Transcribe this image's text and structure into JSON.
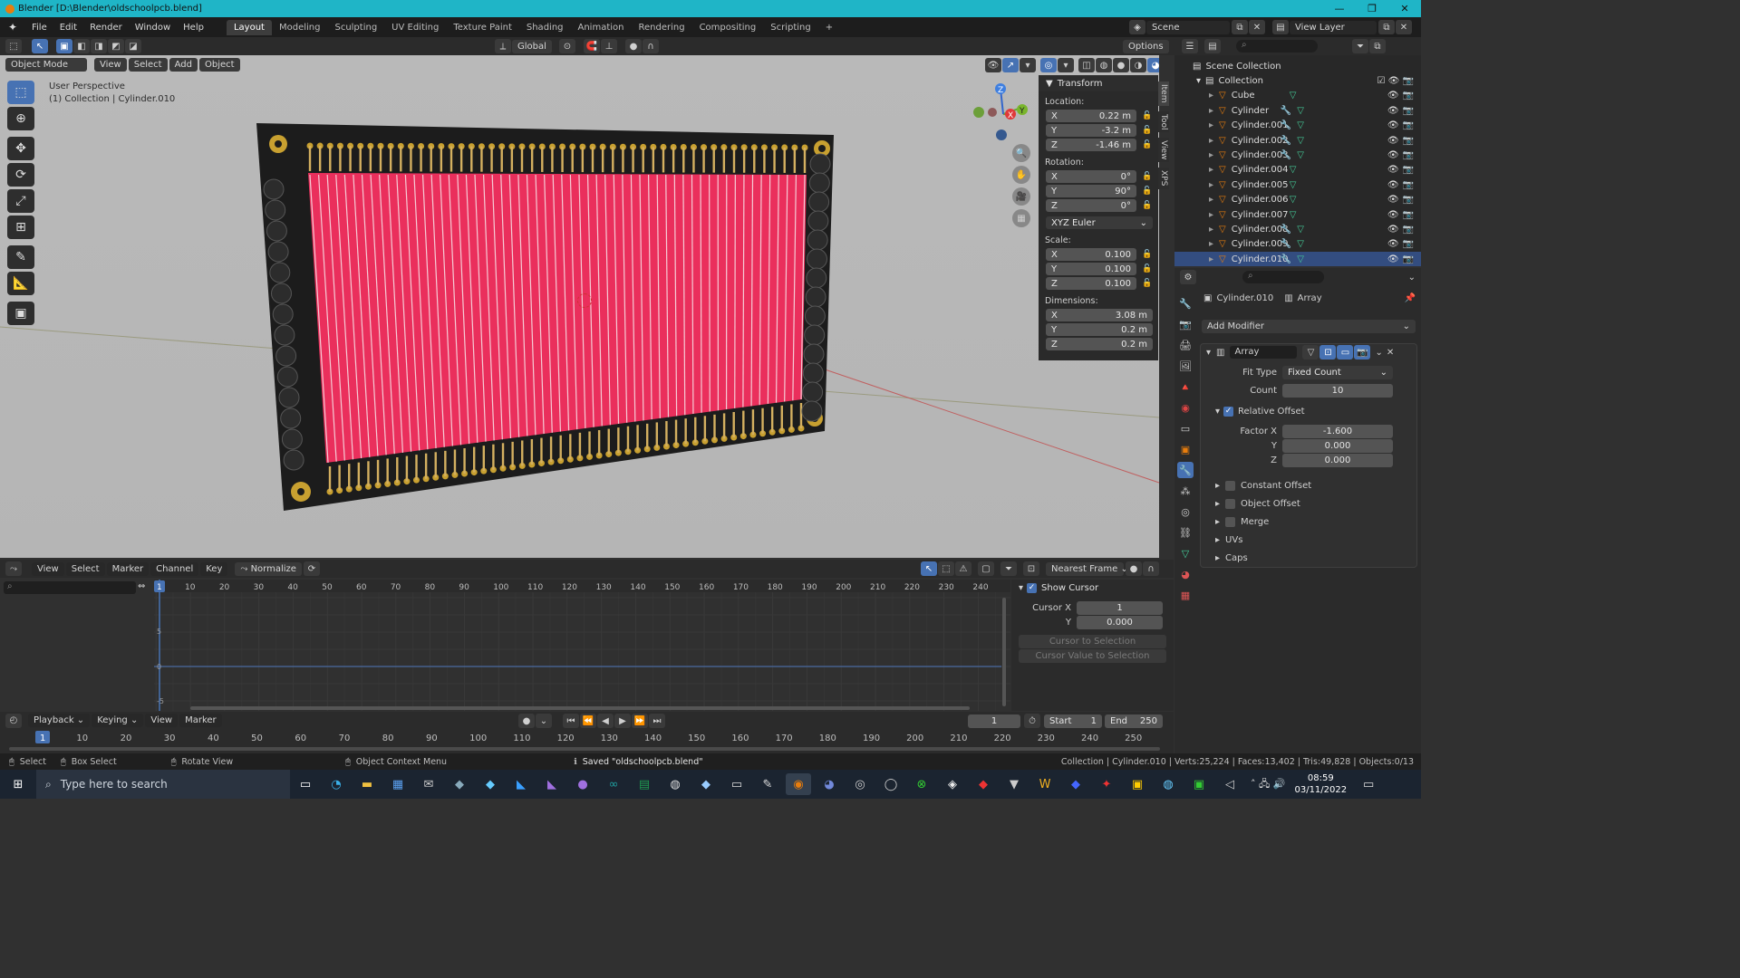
{
  "window": {
    "title": "Blender [D:\\Blender\\oldschoolpcb.blend]",
    "minimize": "—",
    "maximize": "❐",
    "close": "✕"
  },
  "menubar": {
    "menus": [
      "File",
      "Edit",
      "Render",
      "Window",
      "Help"
    ],
    "workspaces": [
      "Layout",
      "Modeling",
      "Sculpting",
      "UV Editing",
      "Texture Paint",
      "Shading",
      "Animation",
      "Rendering",
      "Compositing",
      "Scripting"
    ],
    "active_workspace": "Layout",
    "add_tab": "+",
    "scene": "Scene",
    "view_layer": "View Layer"
  },
  "tool_header": {
    "transform_orientation": "Global",
    "options": "Options"
  },
  "viewport_header": {
    "mode": "Object Mode",
    "menus": [
      "View",
      "Select",
      "Add",
      "Object"
    ]
  },
  "viewport": {
    "perspective": "User Perspective",
    "collection_info": "(1) Collection | Cylinder.010",
    "gizmo_axes": [
      "X",
      "Y",
      "Z"
    ]
  },
  "transform_panel": {
    "title": "Transform",
    "location_label": "Location:",
    "location": {
      "x": "0.22 m",
      "y": "-3.2 m",
      "z": "-1.46 m"
    },
    "rotation_label": "Rotation:",
    "rotation": {
      "x": "0°",
      "y": "90°",
      "z": "0°"
    },
    "rotation_mode": "XYZ Euler",
    "scale_label": "Scale:",
    "scale": {
      "x": "0.100",
      "y": "0.100",
      "z": "0.100"
    },
    "dimensions_label": "Dimensions:",
    "dimensions": {
      "x": "3.08 m",
      "y": "0.2 m",
      "z": "0.2 m"
    },
    "axis_labels": [
      "X",
      "Y",
      "Z"
    ]
  },
  "sidebar_tabs": [
    "Item",
    "Tool",
    "View",
    "XPS"
  ],
  "outliner": {
    "scene_collection": "Scene Collection",
    "collection": "Collection",
    "items": [
      {
        "name": "Cube",
        "modifier": false
      },
      {
        "name": "Cylinder",
        "modifier": true
      },
      {
        "name": "Cylinder.001",
        "modifier": true
      },
      {
        "name": "Cylinder.002",
        "modifier": true
      },
      {
        "name": "Cylinder.003",
        "modifier": true
      },
      {
        "name": "Cylinder.004",
        "modifier": false
      },
      {
        "name": "Cylinder.005",
        "modifier": false
      },
      {
        "name": "Cylinder.006",
        "modifier": false
      },
      {
        "name": "Cylinder.007",
        "modifier": false
      },
      {
        "name": "Cylinder.008",
        "modifier": true
      },
      {
        "name": "Cylinder.009",
        "modifier": true
      },
      {
        "name": "Cylinder.010",
        "modifier": true
      }
    ]
  },
  "properties": {
    "object_name": "Cylinder.010",
    "modifier_context": "Array",
    "add_modifier": "Add Modifier",
    "modifier_name": "Array",
    "fit_type_label": "Fit Type",
    "fit_type": "Fixed Count",
    "count_label": "Count",
    "count": "10",
    "relative_offset": "Relative Offset",
    "factor_x_label": "Factor X",
    "factor_x": "-1.600",
    "factor_y_label": "Y",
    "factor_y": "0.000",
    "factor_z_label": "Z",
    "factor_z": "0.000",
    "subpanels": [
      "Constant Offset",
      "Object Offset",
      "Merge",
      "UVs",
      "Caps"
    ]
  },
  "graph_editor": {
    "menus": [
      "View",
      "Select",
      "Marker",
      "Channel",
      "Key"
    ],
    "normalize": "Normalize",
    "snap": "Nearest Frame",
    "current_frame": "1",
    "ruler": [
      "10",
      "20",
      "30",
      "40",
      "50",
      "60",
      "70",
      "80",
      "90",
      "100",
      "110",
      "120",
      "130",
      "140",
      "150",
      "160",
      "170",
      "180",
      "190",
      "200",
      "210",
      "220",
      "230",
      "240"
    ],
    "y_ticks": [
      "5",
      "0",
      "-5"
    ],
    "show_cursor": "Show Cursor",
    "cursor_x_label": "Cursor X",
    "cursor_x": "1",
    "cursor_y_label": "Y",
    "cursor_y": "0.000",
    "cursor_to_selection": "Cursor to Selection",
    "cursor_value_to_selection": "Cursor Value to Selection"
  },
  "timeline": {
    "menus": [
      "Playback",
      "Keying",
      "View",
      "Marker"
    ],
    "current_frame": "1",
    "start_label": "Start",
    "start": "1",
    "end_label": "End",
    "end": "250",
    "ruler": [
      "10",
      "20",
      "30",
      "40",
      "50",
      "60",
      "70",
      "80",
      "90",
      "100",
      "110",
      "120",
      "130",
      "140",
      "150",
      "160",
      "170",
      "180",
      "190",
      "200",
      "210",
      "220",
      "230",
      "240",
      "250"
    ]
  },
  "statusbar": {
    "select": "Select",
    "box_select": "Box Select",
    "rotate_view": "Rotate View",
    "context_menu": "Object Context Menu",
    "saved": "Saved \"oldschoolpcb.blend\"",
    "stats": "Collection | Cylinder.010 | Verts:25,224 | Faces:13,402 | Tris:49,828 | Objects:0/13"
  },
  "taskbar": {
    "search_placeholder": "Type here to search",
    "time": "08:59",
    "date": "03/11/2022"
  },
  "colors": {
    "accent": "#4772b3",
    "titlebar": "#1fb5c7",
    "pcb_pink": "#e8305c",
    "pad_gold": "#c8a030"
  }
}
